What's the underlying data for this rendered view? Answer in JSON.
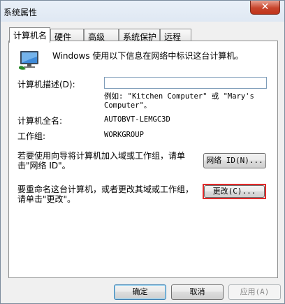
{
  "window": {
    "title": "系统属性",
    "close_glyph": "✕"
  },
  "tabs": [
    {
      "label": "计算机名",
      "active": true
    },
    {
      "label": "硬件",
      "active": false
    },
    {
      "label": "高级",
      "active": false
    },
    {
      "label": "系统保护",
      "active": false
    },
    {
      "label": "远程",
      "active": false
    }
  ],
  "computer_name_tab": {
    "icon": "computer-icon",
    "intro": "Windows 使用以下信息在网络中标识这台计算机。",
    "description_label": "计算机描述(D):",
    "description_value": "",
    "example_text": "例如: \"Kitchen Computer\" 或 \"Mary's Computer\"。",
    "full_name_label": "计算机全名:",
    "full_name_value": "AUTOBVT-LEMGC3D",
    "workgroup_label": "工作组:",
    "workgroup_value": "WORKGROUP",
    "network_id_text": "若要使用向导将计算机加入域或工作组，请单击\"网络 ID\"。",
    "network_id_button": "网络 ID(N)...",
    "rename_text": "要重命名这台计算机，或者更改其域或工作组，请单击\"更改\"。",
    "change_button": "更改(C)..."
  },
  "footer": {
    "ok": "确定",
    "cancel": "取消",
    "apply": "应用(A)"
  },
  "colors": {
    "highlight_border": "#e02a2a",
    "close_button": "#c8452c"
  }
}
